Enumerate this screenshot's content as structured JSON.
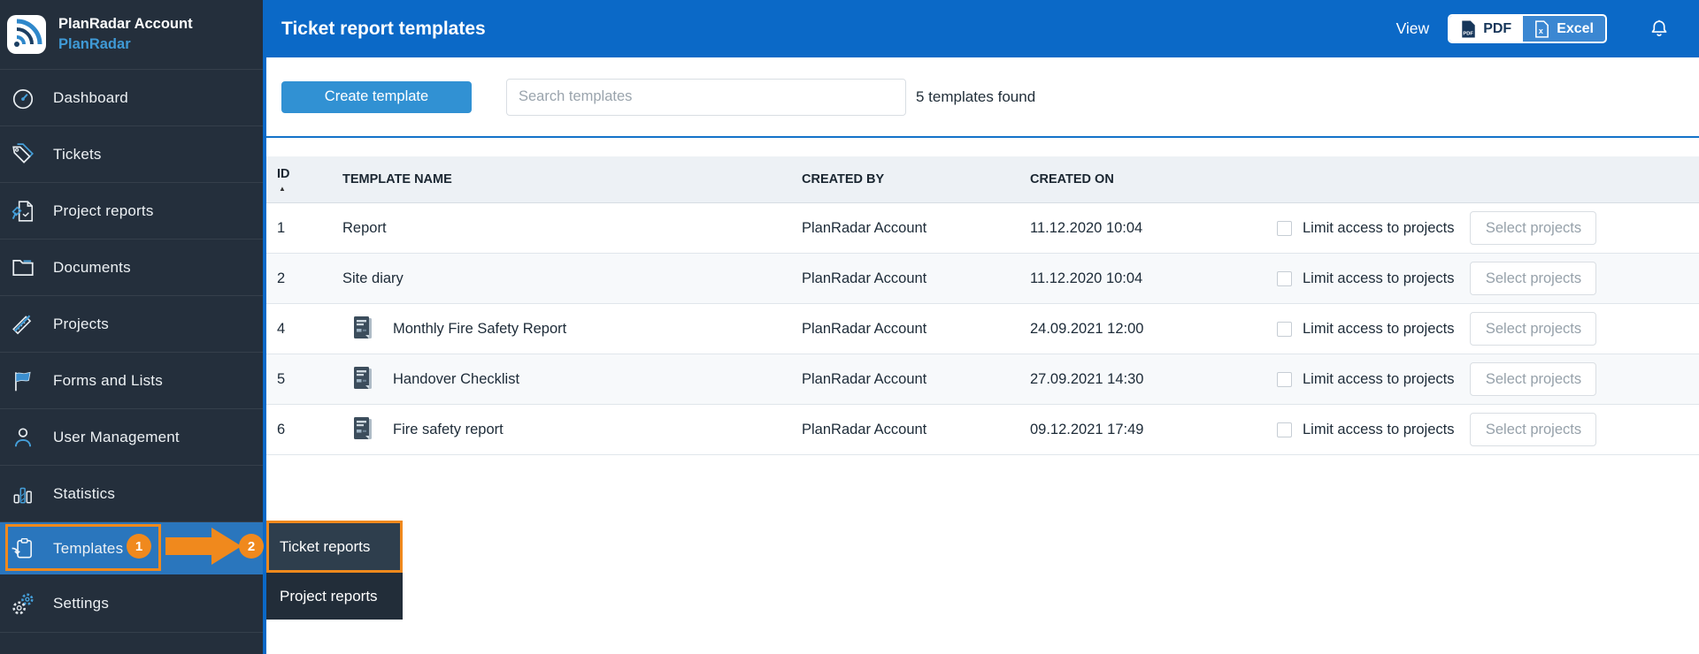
{
  "sidebar": {
    "account_name": "PlanRadar Account",
    "account_sub": "PlanRadar",
    "items": [
      {
        "label": "Dashboard",
        "icon": "dashboard-gauge-icon"
      },
      {
        "label": "Tickets",
        "icon": "tickets-tag-icon"
      },
      {
        "label": "Project reports",
        "icon": "project-reports-icon"
      },
      {
        "label": "Documents",
        "icon": "documents-folder-icon"
      },
      {
        "label": "Projects",
        "icon": "projects-ruler-pencil-icon"
      },
      {
        "label": "Forms and Lists",
        "icon": "forms-flag-icon"
      },
      {
        "label": "User Management",
        "icon": "user-management-icon"
      },
      {
        "label": "Statistics",
        "icon": "statistics-bars-icon"
      }
    ],
    "templates_item": {
      "label": "Templates",
      "icon": "templates-clipboard-icon"
    },
    "settings_item": {
      "label": "Settings",
      "icon": "settings-gears-icon"
    }
  },
  "submenu": {
    "items": [
      {
        "label": "Ticket reports"
      },
      {
        "label": "Project reports"
      }
    ]
  },
  "annotation": {
    "step1": "1",
    "step2": "2"
  },
  "header": {
    "title": "Ticket report templates",
    "view_label": "View",
    "pdf_label": "PDF",
    "excel_label": "Excel"
  },
  "toolbar": {
    "create_button": "Create template",
    "search_placeholder": "Search templates",
    "results_count": "5 templates found"
  },
  "table": {
    "columns": [
      "ID",
      "TEMPLATE NAME",
      "CREATED BY",
      "CREATED ON"
    ],
    "sort_icon": "▲",
    "limit_label": "Limit access to projects",
    "select_button": "Select projects",
    "rows": [
      {
        "id": "1",
        "name": "Report",
        "created_by": "PlanRadar Account",
        "created_on": "11.12.2020 10:04",
        "has_icon": false
      },
      {
        "id": "2",
        "name": "Site diary",
        "created_by": "PlanRadar Account",
        "created_on": "11.12.2020 10:04",
        "has_icon": false
      },
      {
        "id": "4",
        "name": "Monthly Fire Safety Report",
        "created_by": "PlanRadar Account",
        "created_on": "24.09.2021 12:00",
        "has_icon": true
      },
      {
        "id": "5",
        "name": "Handover Checklist",
        "created_by": "PlanRadar Account",
        "created_on": "27.09.2021 14:30",
        "has_icon": true
      },
      {
        "id": "6",
        "name": "Fire safety report",
        "created_by": "PlanRadar Account",
        "created_on": "09.12.2021 17:49",
        "has_icon": true
      }
    ]
  },
  "colors": {
    "header_blue": "#0b69c7",
    "active_item_blue": "#2a76bd",
    "annotation_orange": "#f0891d",
    "create_button_blue": "#3191d3",
    "sidebar_bg": "#242f3c",
    "accent_blue": "#3f9ad6"
  }
}
